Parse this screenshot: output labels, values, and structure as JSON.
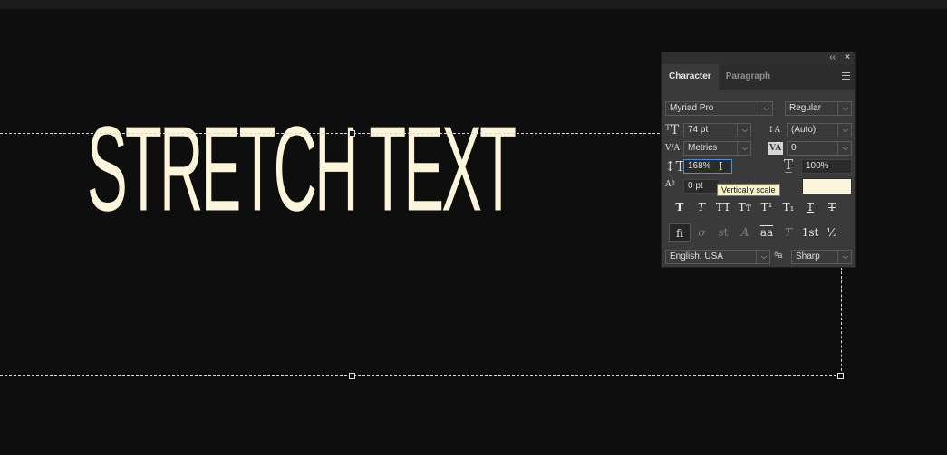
{
  "canvas": {
    "text": "STRETCH TEXT",
    "text_color": "#fdf4dc"
  },
  "panel": {
    "tabs": [
      {
        "label": "Character"
      },
      {
        "label": "Paragraph"
      }
    ],
    "font_family": "Myriad Pro",
    "font_style": "Regular",
    "font_size": "74 pt",
    "leading": "(Auto)",
    "kerning": "Metrics",
    "tracking": "0",
    "vertical_scale": "168%",
    "horizontal_scale": "100%",
    "baseline_shift": "0 pt",
    "color_swatch": "#fdf4dc",
    "tooltip": "Vertically scale",
    "style_buttons": [
      "T",
      "T",
      "TT",
      "Tт",
      "T¹",
      "T₁",
      "T",
      "T"
    ],
    "opentype_buttons": [
      "fi",
      "ơ",
      "st",
      "A",
      "aa",
      "T",
      "1st",
      "½"
    ],
    "language": "English: USA",
    "antialias_icon_label": "ªa",
    "antialias": "Sharp"
  }
}
